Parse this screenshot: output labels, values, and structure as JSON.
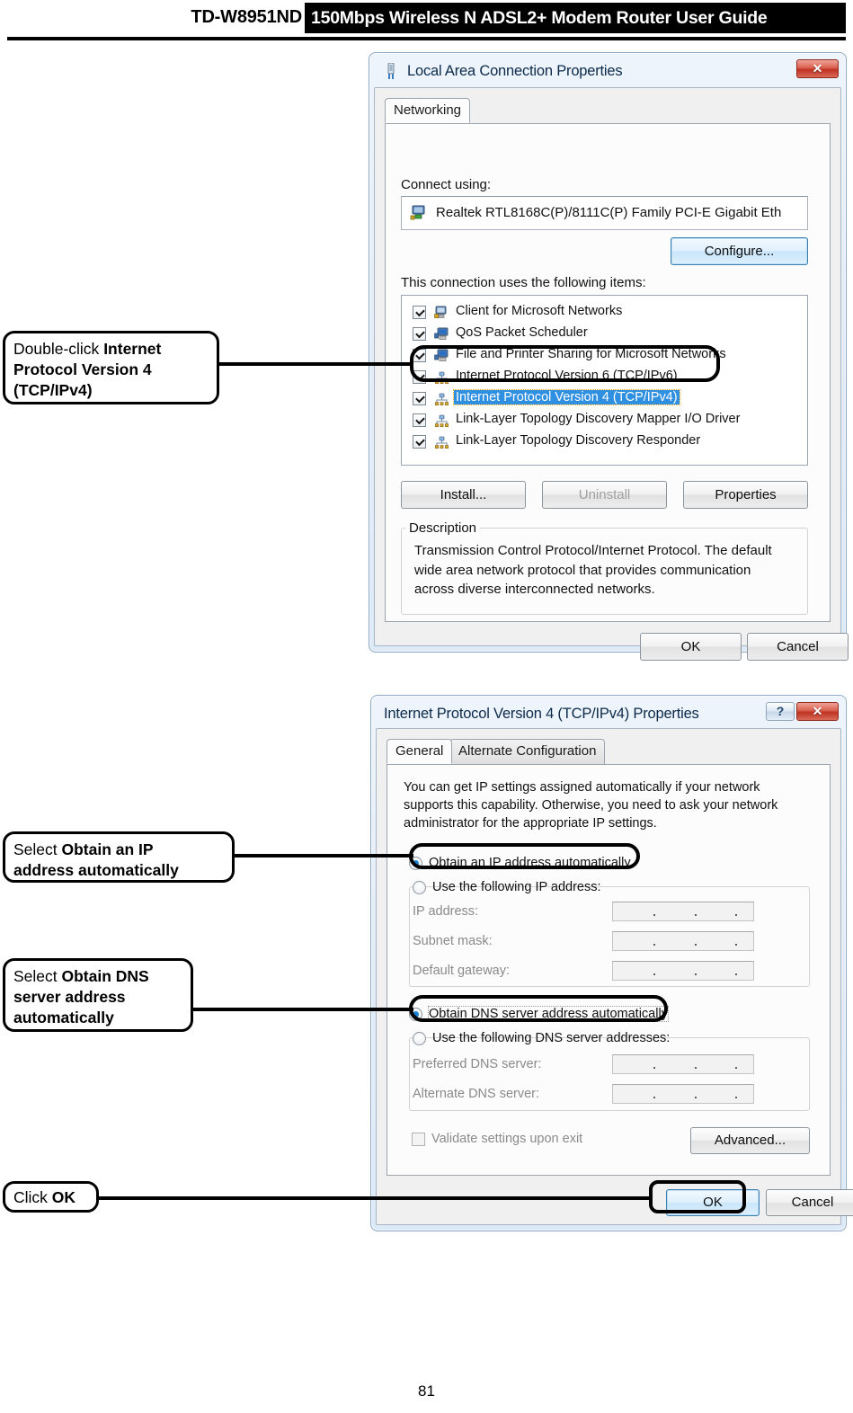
{
  "header": {
    "model": "TD-W8951ND",
    "title": "150Mbps Wireless N ADSL2+ Modem Router User Guide"
  },
  "page_number": "81",
  "dialog1": {
    "title": "Local Area Connection Properties",
    "title_icon": "network-adapter-icon",
    "close_label": "✕",
    "tabs": [
      {
        "label": "Networking",
        "active": true
      }
    ],
    "connect_using_label": "Connect using:",
    "adapter": {
      "icon": "network-adapter-icon",
      "name": "Realtek RTL8168C(P)/8111C(P) Family PCI-E Gigabit Eth"
    },
    "configure_button": "Configure...",
    "items_label": "This connection uses the following items:",
    "items": [
      {
        "label": "Client for Microsoft Networks",
        "checked": true,
        "selected": false,
        "icon": "client-network-icon"
      },
      {
        "label": "QoS Packet Scheduler",
        "checked": true,
        "selected": false,
        "icon": "service-icon"
      },
      {
        "label": "File and Printer Sharing for Microsoft Networks",
        "checked": true,
        "selected": false,
        "icon": "service-icon"
      },
      {
        "label": "Internet Protocol Version 6 (TCP/IPv6)",
        "checked": true,
        "selected": false,
        "icon": "protocol-icon"
      },
      {
        "label": "Internet Protocol Version 4 (TCP/IPv4)",
        "checked": true,
        "selected": true,
        "icon": "protocol-icon"
      },
      {
        "label": "Link-Layer Topology Discovery Mapper I/O Driver",
        "checked": true,
        "selected": false,
        "icon": "protocol-icon"
      },
      {
        "label": "Link-Layer Topology Discovery Responder",
        "checked": true,
        "selected": false,
        "icon": "protocol-icon"
      }
    ],
    "install_button": "Install...",
    "uninstall_button": "Uninstall",
    "properties_button": "Properties",
    "description_legend": "Description",
    "description_text": "Transmission Control Protocol/Internet Protocol. The default wide area network protocol that provides communication across diverse interconnected networks.",
    "ok_button": "OK",
    "cancel_button": "Cancel"
  },
  "dialog2": {
    "title": "Internet Protocol Version 4 (TCP/IPv4) Properties",
    "help_label": "?",
    "close_label": "✕",
    "tabs": [
      {
        "label": "General",
        "active": true
      },
      {
        "label": "Alternate Configuration",
        "active": false
      }
    ],
    "intro_text": "You can get IP settings assigned automatically if your network supports this capability. Otherwise, you need to ask your network administrator for the appropriate IP settings.",
    "radio_obtain_ip": {
      "label": "Obtain an IP address automatically",
      "selected": true
    },
    "radio_use_ip": {
      "label": "Use the following IP address:",
      "selected": false
    },
    "ip_fields": [
      {
        "label": "IP address:",
        "value": ""
      },
      {
        "label": "Subnet mask:",
        "value": ""
      },
      {
        "label": "Default gateway:",
        "value": ""
      }
    ],
    "radio_obtain_dns": {
      "label": "Obtain DNS server address automatically",
      "selected": true
    },
    "radio_use_dns": {
      "label": "Use the following DNS server addresses:",
      "selected": false
    },
    "dns_fields": [
      {
        "label": "Preferred DNS server:",
        "value": ""
      },
      {
        "label": "Alternate DNS server:",
        "value": ""
      }
    ],
    "validate_checkbox": {
      "label": "Validate settings upon exit",
      "checked": false
    },
    "advanced_button": "Advanced...",
    "ok_button": "OK",
    "cancel_button": "Cancel"
  },
  "callouts": [
    {
      "id": "callout-tcpipv4",
      "line1_plain": "Double-click ",
      "line1_bold": "Internet",
      "line2_bold": "Protocol Version 4",
      "line3_bold": "(TCP/IPv4)"
    },
    {
      "id": "callout-obtain-ip",
      "line1_plain": "Select ",
      "line1_bold": "Obtain an IP",
      "line2_bold": "address automatically"
    },
    {
      "id": "callout-obtain-dns",
      "line1_plain": "Select ",
      "line1_bold": "Obtain DNS",
      "line2_bold": "server address",
      "line3_bold": "automatically"
    },
    {
      "id": "callout-click-ok",
      "line1_plain": "Click ",
      "line1_bold": "OK"
    }
  ],
  "colors": {
    "accent_selection": "#2f8fe0",
    "close_button": "#bf3222",
    "dialog_face": "#f0f0f0",
    "panel": "#fcfcfc"
  }
}
